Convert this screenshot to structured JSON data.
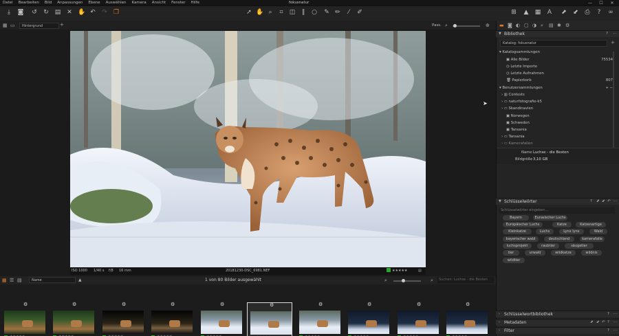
{
  "app": {
    "title": "fokusnatur"
  },
  "menu": [
    "Datei",
    "Bearbeiten",
    "Bild",
    "Anpassungen",
    "Ebene",
    "Auswählen",
    "Kamera",
    "Ansicht",
    "Fenster",
    "Hilfe"
  ],
  "window": {
    "minimize": "—",
    "maximize": "☐",
    "close": "✕"
  },
  "viewer": {
    "background_select": "Hintergrund",
    "zoom_label": "Pass."
  },
  "photo": {
    "iso": "ISO 1000",
    "shutter": "1/40 s",
    "aperture": "f/8",
    "focal": "16 mm",
    "filename": "20181230-DSC_6981.NEF",
    "rating": "★★★★★"
  },
  "browser": {
    "sort": "Name",
    "status": "1 von 80 Bilder ausgewählt",
    "search_placeholder": "Suchen: Luchse - die Besten"
  },
  "thumbs": [
    {
      "stars": "★★★★★",
      "selected": false,
      "style": "night"
    },
    {
      "stars": "★★★★★",
      "selected": false,
      "style": "night"
    },
    {
      "stars": "★★★★★",
      "selected": false,
      "style": "dark"
    },
    {
      "stars": "★★★★★",
      "selected": false,
      "style": "dark"
    },
    {
      "stars": "★★★★★",
      "selected": false,
      "style": "snow"
    },
    {
      "stars": "★★★★★",
      "selected": true,
      "style": "snow"
    },
    {
      "stars": "★★★★★",
      "selected": false,
      "style": "snow"
    },
    {
      "stars": "★★★★★",
      "selected": false,
      "style": "blue"
    },
    {
      "stars": "★★★★★",
      "selected": false,
      "style": "blue"
    },
    {
      "stars": "★★★★★",
      "selected": false,
      "style": "blue"
    }
  ],
  "library": {
    "title": "Bibliothek",
    "catalog": "Katalog: fokusnatur",
    "catalog_collections": "Katalogsammlungen",
    "items": [
      {
        "label": "Alle Bilder",
        "count": "75534"
      },
      {
        "label": "Letzte Importe",
        "count": ""
      },
      {
        "label": "Letzte Aufnahmen",
        "count": ""
      },
      {
        "label": "Papierkorb",
        "count": "807"
      }
    ],
    "user_collections": "Benutzersammlungen",
    "user_items": [
      "Contests",
      "naturfotografie-k5",
      "Skandinavien",
      "Norwegen",
      "Schweden",
      "Tansania",
      "Tansania",
      "Kamerafallen"
    ],
    "name_label": "Name",
    "name_value": "Luchse - die Besten",
    "size_label": "Bildgröße",
    "size_value": "3,10 GB"
  },
  "keywords": {
    "title": "Schlüsselwörter",
    "placeholder": "Schlüsselwörter eingeben...",
    "tags": [
      "Bayern",
      "Eurasischer Luchs",
      "Europäischer Luchs",
      "Katze",
      "Katzenartige",
      "Kleinkatze",
      "Luchs",
      "Lynx lynx",
      "Wald",
      "bayerischer wald",
      "deutschland",
      "kamerafalle",
      "luchsprojekt",
      "raubtier",
      "säugetier",
      "tier",
      "urwald",
      "wildkatze",
      "wildnis",
      "wildtier"
    ]
  },
  "panels": {
    "keyword_library": "Schlüsselwortbibliothek",
    "metadata": "Metadaten",
    "filter": "Filter"
  }
}
